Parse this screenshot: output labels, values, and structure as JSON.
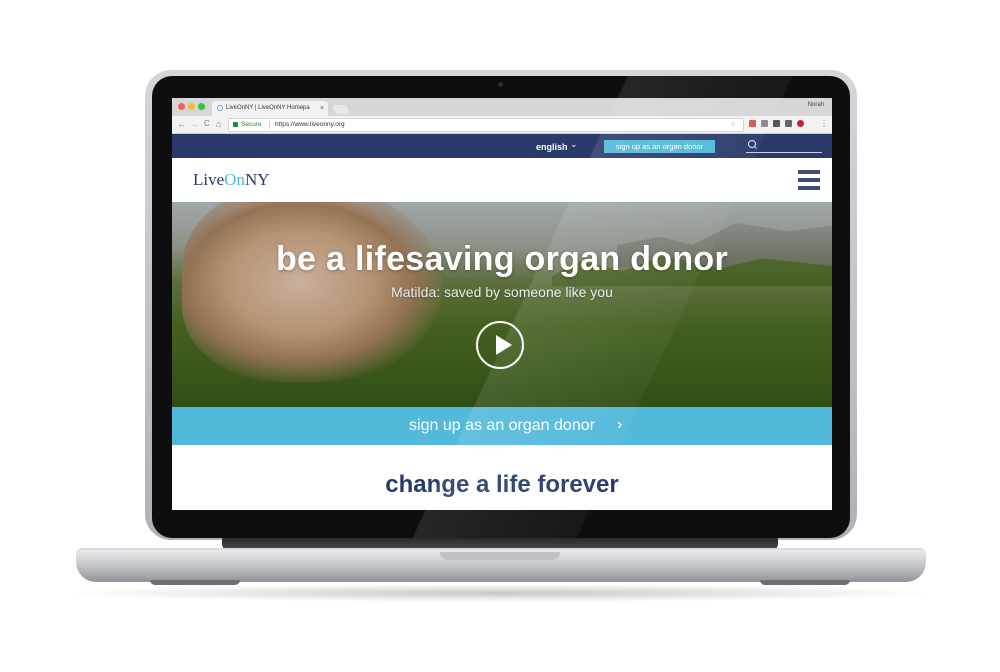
{
  "browser": {
    "tab_title": "LiveOnNY | LiveOnNY Homepa",
    "tab_close": "×",
    "profile_name": "Norah",
    "nav": {
      "back": "←",
      "forward": "→",
      "reload": "C",
      "home": "⌂"
    },
    "secure_label": "Secure",
    "url": "https://www.liveonny.org",
    "star": "☆",
    "menu": "⋮"
  },
  "site": {
    "utility": {
      "language": "english",
      "language_chevron": "⌄",
      "cta_label": "sign up as an organ donor"
    },
    "logo": {
      "part1": "Live",
      "part2": "On",
      "part3": "NY"
    },
    "hero": {
      "title": "be a lifesaving organ donor",
      "subtitle": "Matilda: saved by someone like you"
    },
    "cta": {
      "label": "sign up as an organ donor",
      "chevron": "›"
    },
    "tagline": "change a life forever"
  },
  "colors": {
    "navy": "#2b3a6a",
    "accent": "#52b9db",
    "heading": "#273a6b"
  },
  "icons": [
    "search-icon",
    "menu-icon",
    "play-icon",
    "chevron-right-icon",
    "chevron-down-icon",
    "lock-icon"
  ]
}
